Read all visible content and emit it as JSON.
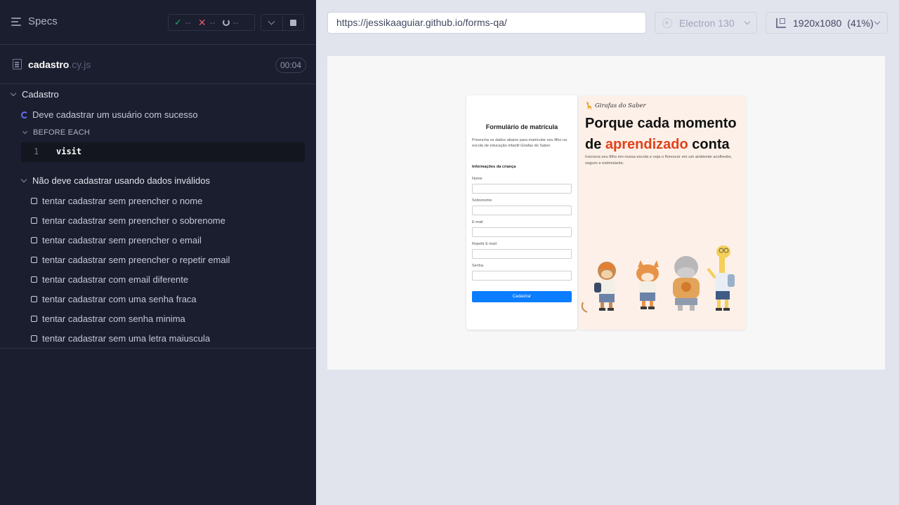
{
  "reporter": {
    "specs_label": "Specs",
    "stats": {
      "passed": "--",
      "failed": "--",
      "pending": "--"
    },
    "file": {
      "name": "cadastro",
      "ext": ".cy.js",
      "duration": "00:04"
    },
    "suite": {
      "title": "Cadastro",
      "running_test": "Deve cadastrar um usuário com sucesso",
      "hook_title": "BEFORE EACH",
      "command": {
        "number": "1",
        "name": "visit"
      },
      "nested_suite": {
        "title": "Não deve cadastrar usando dados inválidos",
        "tests": [
          "tentar cadastrar sem preencher o nome",
          "tentar cadastrar sem preencher o sobrenome",
          "tentar cadastrar sem preencher o email",
          "tentar cadastrar sem preencher o repetir email",
          "tentar cadastrar com email diferente",
          "tentar cadastrar com uma senha fraca",
          "tentar cadastrar com senha minima",
          "tentar cadastrar sem uma letra maiuscula"
        ]
      }
    }
  },
  "aut_header": {
    "url": "https://jessikaaguiar.github.io/forms-qa/",
    "browser": "Electron 130",
    "viewport": "1920x1080",
    "scale": "(41%)"
  },
  "aut_page": {
    "form": {
      "title": "Formulário de matrícula",
      "description": "Preencha os dados abaixo para matricular seu filho na escola de educação infantil Girafas do Saber.",
      "section": "Informações da criança",
      "fields": [
        "Nome",
        "Sobrenome",
        "E-mail",
        "Repetir E-mail",
        "Senha"
      ],
      "submit": "Cadastrar"
    },
    "hero": {
      "brand": "Girafas do Saber",
      "title_line1": "Porque cada momento",
      "title_de": "de",
      "title_accent": "aprendizado",
      "title_end": "conta",
      "subtitle": "Inscreva seu filho em nossa escola e veja o florescer em um ambiente acolhedor, seguro e estimulante."
    }
  }
}
